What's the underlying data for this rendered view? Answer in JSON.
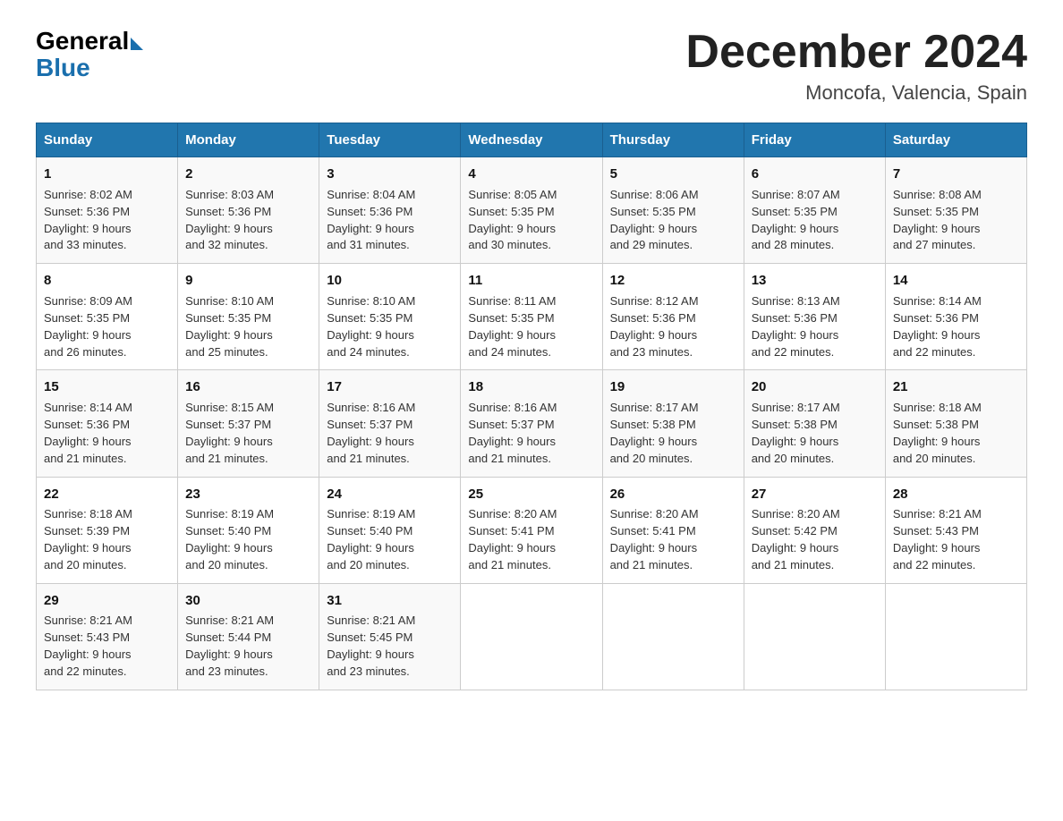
{
  "logo": {
    "general": "General",
    "blue": "Blue"
  },
  "title": "December 2024",
  "location": "Moncofa, Valencia, Spain",
  "days_header": [
    "Sunday",
    "Monday",
    "Tuesday",
    "Wednesday",
    "Thursday",
    "Friday",
    "Saturday"
  ],
  "weeks": [
    [
      {
        "day": "1",
        "sunrise": "8:02 AM",
        "sunset": "5:36 PM",
        "daylight": "9 hours and 33 minutes."
      },
      {
        "day": "2",
        "sunrise": "8:03 AM",
        "sunset": "5:36 PM",
        "daylight": "9 hours and 32 minutes."
      },
      {
        "day": "3",
        "sunrise": "8:04 AM",
        "sunset": "5:36 PM",
        "daylight": "9 hours and 31 minutes."
      },
      {
        "day": "4",
        "sunrise": "8:05 AM",
        "sunset": "5:35 PM",
        "daylight": "9 hours and 30 minutes."
      },
      {
        "day": "5",
        "sunrise": "8:06 AM",
        "sunset": "5:35 PM",
        "daylight": "9 hours and 29 minutes."
      },
      {
        "day": "6",
        "sunrise": "8:07 AM",
        "sunset": "5:35 PM",
        "daylight": "9 hours and 28 minutes."
      },
      {
        "day": "7",
        "sunrise": "8:08 AM",
        "sunset": "5:35 PM",
        "daylight": "9 hours and 27 minutes."
      }
    ],
    [
      {
        "day": "8",
        "sunrise": "8:09 AM",
        "sunset": "5:35 PM",
        "daylight": "9 hours and 26 minutes."
      },
      {
        "day": "9",
        "sunrise": "8:10 AM",
        "sunset": "5:35 PM",
        "daylight": "9 hours and 25 minutes."
      },
      {
        "day": "10",
        "sunrise": "8:10 AM",
        "sunset": "5:35 PM",
        "daylight": "9 hours and 24 minutes."
      },
      {
        "day": "11",
        "sunrise": "8:11 AM",
        "sunset": "5:35 PM",
        "daylight": "9 hours and 24 minutes."
      },
      {
        "day": "12",
        "sunrise": "8:12 AM",
        "sunset": "5:36 PM",
        "daylight": "9 hours and 23 minutes."
      },
      {
        "day": "13",
        "sunrise": "8:13 AM",
        "sunset": "5:36 PM",
        "daylight": "9 hours and 22 minutes."
      },
      {
        "day": "14",
        "sunrise": "8:14 AM",
        "sunset": "5:36 PM",
        "daylight": "9 hours and 22 minutes."
      }
    ],
    [
      {
        "day": "15",
        "sunrise": "8:14 AM",
        "sunset": "5:36 PM",
        "daylight": "9 hours and 21 minutes."
      },
      {
        "day": "16",
        "sunrise": "8:15 AM",
        "sunset": "5:37 PM",
        "daylight": "9 hours and 21 minutes."
      },
      {
        "day": "17",
        "sunrise": "8:16 AM",
        "sunset": "5:37 PM",
        "daylight": "9 hours and 21 minutes."
      },
      {
        "day": "18",
        "sunrise": "8:16 AM",
        "sunset": "5:37 PM",
        "daylight": "9 hours and 21 minutes."
      },
      {
        "day": "19",
        "sunrise": "8:17 AM",
        "sunset": "5:38 PM",
        "daylight": "9 hours and 20 minutes."
      },
      {
        "day": "20",
        "sunrise": "8:17 AM",
        "sunset": "5:38 PM",
        "daylight": "9 hours and 20 minutes."
      },
      {
        "day": "21",
        "sunrise": "8:18 AM",
        "sunset": "5:38 PM",
        "daylight": "9 hours and 20 minutes."
      }
    ],
    [
      {
        "day": "22",
        "sunrise": "8:18 AM",
        "sunset": "5:39 PM",
        "daylight": "9 hours and 20 minutes."
      },
      {
        "day": "23",
        "sunrise": "8:19 AM",
        "sunset": "5:40 PM",
        "daylight": "9 hours and 20 minutes."
      },
      {
        "day": "24",
        "sunrise": "8:19 AM",
        "sunset": "5:40 PM",
        "daylight": "9 hours and 20 minutes."
      },
      {
        "day": "25",
        "sunrise": "8:20 AM",
        "sunset": "5:41 PM",
        "daylight": "9 hours and 21 minutes."
      },
      {
        "day": "26",
        "sunrise": "8:20 AM",
        "sunset": "5:41 PM",
        "daylight": "9 hours and 21 minutes."
      },
      {
        "day": "27",
        "sunrise": "8:20 AM",
        "sunset": "5:42 PM",
        "daylight": "9 hours and 21 minutes."
      },
      {
        "day": "28",
        "sunrise": "8:21 AM",
        "sunset": "5:43 PM",
        "daylight": "9 hours and 22 minutes."
      }
    ],
    [
      {
        "day": "29",
        "sunrise": "8:21 AM",
        "sunset": "5:43 PM",
        "daylight": "9 hours and 22 minutes."
      },
      {
        "day": "30",
        "sunrise": "8:21 AM",
        "sunset": "5:44 PM",
        "daylight": "9 hours and 23 minutes."
      },
      {
        "day": "31",
        "sunrise": "8:21 AM",
        "sunset": "5:45 PM",
        "daylight": "9 hours and 23 minutes."
      },
      null,
      null,
      null,
      null
    ]
  ],
  "labels": {
    "sunrise": "Sunrise:",
    "sunset": "Sunset:",
    "daylight": "Daylight:"
  }
}
